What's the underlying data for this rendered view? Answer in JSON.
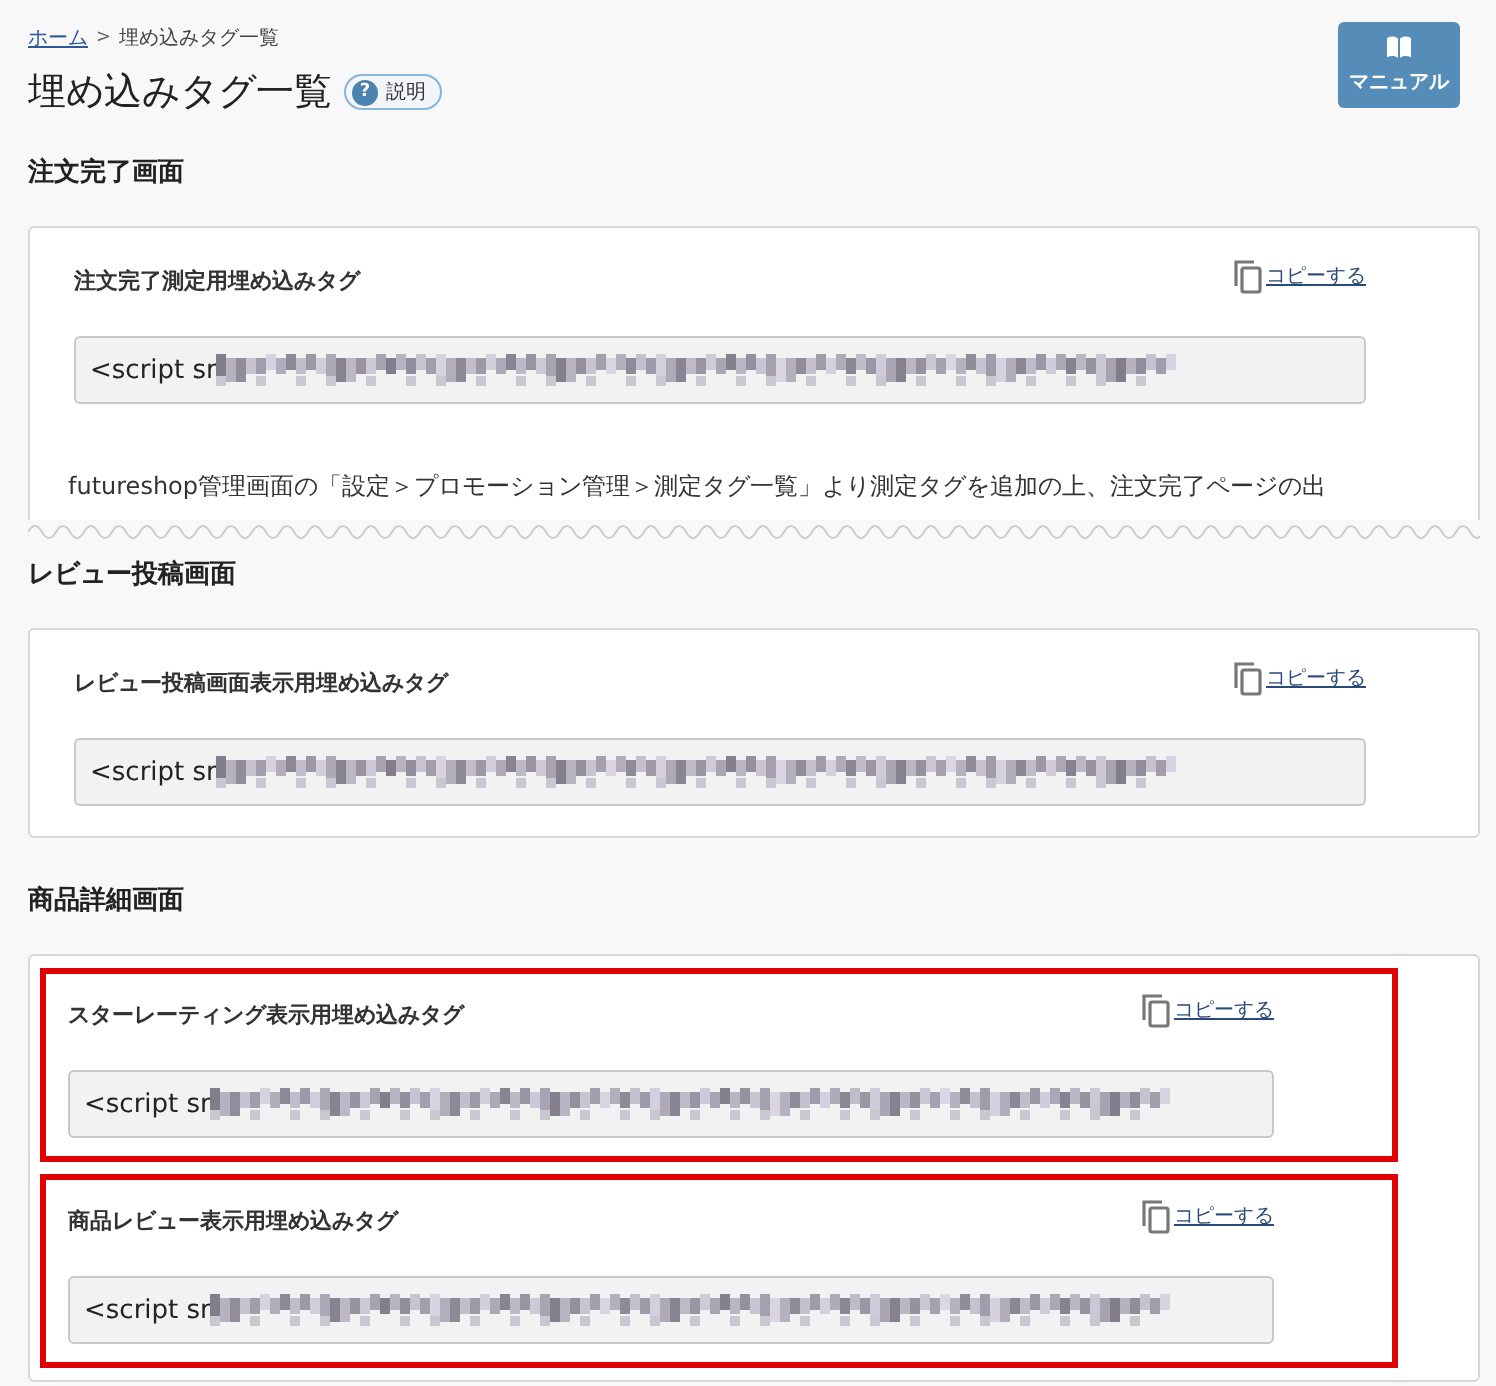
{
  "breadcrumb": [
    {
      "label": "ホーム",
      "kind": "link"
    },
    {
      "label": ">",
      "kind": "separator"
    },
    {
      "label": "埋め込みタグ一覧",
      "kind": "current"
    }
  ],
  "title": "埋め込みタグ一覧",
  "help_badge": {
    "icon": "?",
    "label": "説明"
  },
  "manual_button": {
    "label": "マニュアル"
  },
  "sections": [
    {
      "heading": "注文完了画面",
      "torn": true,
      "tags": [
        {
          "title": "注文完了測定用埋め込みタグ",
          "copy_label": "コピーする",
          "code": "<script sr",
          "highlighted": false
        }
      ],
      "note": "futureshop管理画面の「設定＞プロモーション管理＞測定タグ一覧」より測定タグを追加の上、注文完了ページの出"
    },
    {
      "heading": "レビュー投稿画面",
      "torn": false,
      "tags": [
        {
          "title": "レビュー投稿画面表示用埋め込みタグ",
          "copy_label": "コピーする",
          "code": "<script sr",
          "highlighted": false
        }
      ]
    },
    {
      "heading": "商品詳細画面",
      "torn": false,
      "tags": [
        {
          "title": "スターレーティング表示用埋め込みタグ",
          "copy_label": "コピーする",
          "code": "<script sr",
          "highlighted": true
        },
        {
          "title": "商品レビュー表示用埋め込みタグ",
          "copy_label": "コピーする",
          "code": "<script sr",
          "highlighted": true
        }
      ]
    }
  ]
}
